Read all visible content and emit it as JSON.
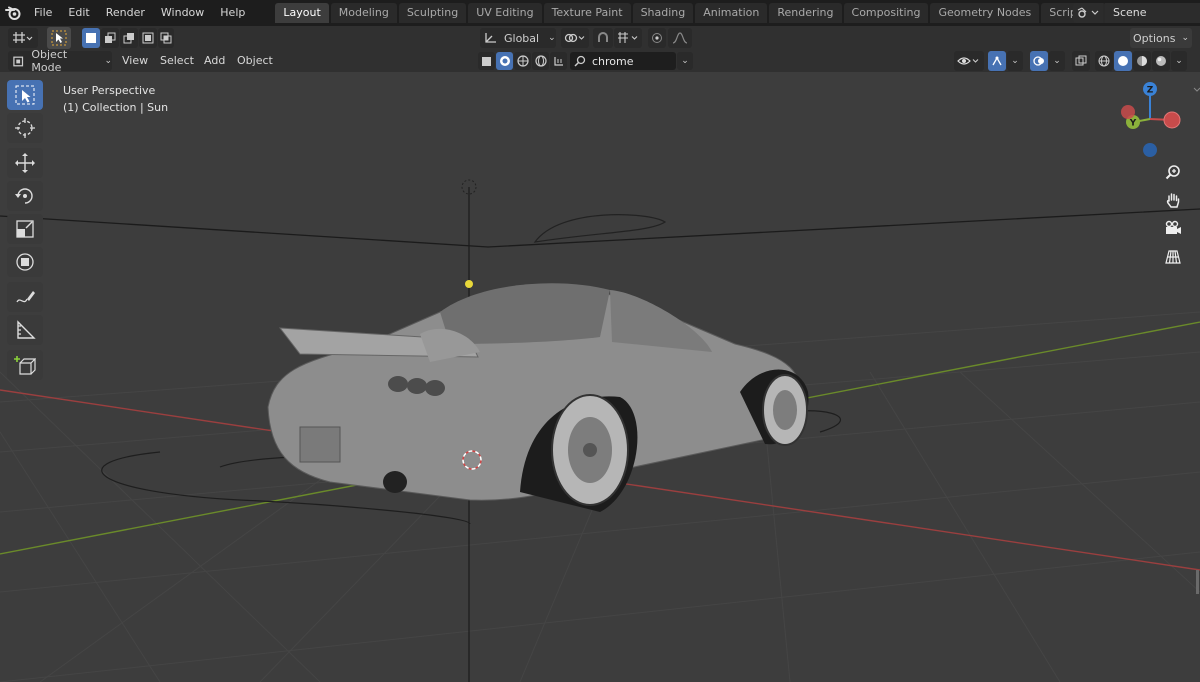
{
  "menubar": {
    "items": [
      "File",
      "Edit",
      "Render",
      "Window",
      "Help"
    ]
  },
  "workspaces": {
    "tabs": [
      "Layout",
      "Modeling",
      "Sculpting",
      "UV Editing",
      "Texture Paint",
      "Shading",
      "Animation",
      "Rendering",
      "Compositing",
      "Geometry Nodes",
      "Scripting"
    ],
    "active": "Layout",
    "add_label": "+"
  },
  "scene": {
    "name": "Scene"
  },
  "tool_header": {
    "transform_orientation": "Global",
    "options_label": "Options"
  },
  "viewport_header": {
    "mode": "Object Mode",
    "menus": [
      "View",
      "Select",
      "Add",
      "Object"
    ],
    "search_value": "chrome"
  },
  "viewport": {
    "perspective": "User Perspective",
    "context": "(1) Collection | Sun"
  },
  "gizmo": {
    "z_label": "Z",
    "y_label": "Y"
  },
  "colors": {
    "accent": "#4772b3",
    "x_axis": "#c84b4b",
    "y_axis": "#8bb13b",
    "z_axis": "#3a82d6",
    "sun_light": "#e8d83a"
  }
}
